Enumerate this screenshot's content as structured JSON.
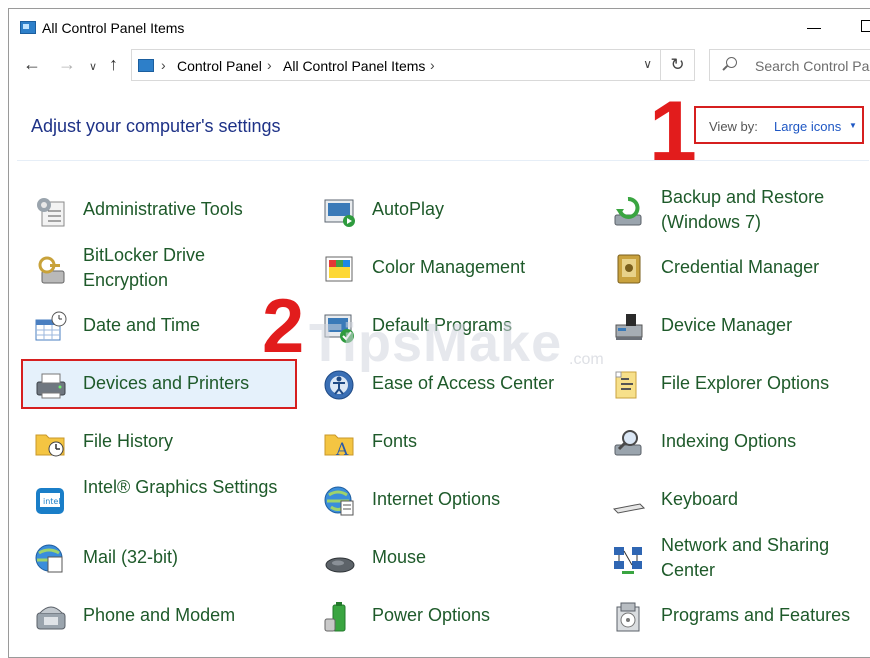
{
  "window": {
    "title": "All Control Panel Items"
  },
  "nav": {
    "breadcrumbs": [
      "Control Panel",
      "All Control Panel Items"
    ],
    "search_placeholder": "Search Control Panel"
  },
  "header": {
    "heading": "Adjust your computer's settings",
    "view_by_label": "View by:",
    "view_by_value": "Large icons"
  },
  "annotations": [
    "1",
    "2"
  ],
  "watermark": {
    "brand": "TipsMake",
    "suffix": ".com"
  },
  "items": [
    {
      "label": "Administrative Tools",
      "icon": "administrative-tools-icon"
    },
    {
      "label": "AutoPlay",
      "icon": "autoplay-icon"
    },
    {
      "label": "Backup and Restore (Windows 7)",
      "icon": "backup-restore-icon"
    },
    {
      "label": "BitLocker Drive Encryption",
      "icon": "bitlocker-icon"
    },
    {
      "label": "Color Management",
      "icon": "color-management-icon"
    },
    {
      "label": "Credential Manager",
      "icon": "credential-manager-icon"
    },
    {
      "label": "Date and Time",
      "icon": "date-time-icon"
    },
    {
      "label": "Default Programs",
      "icon": "default-programs-icon"
    },
    {
      "label": "Device Manager",
      "icon": "device-manager-icon"
    },
    {
      "label": "Devices and Printers",
      "icon": "devices-printers-icon",
      "selected": true
    },
    {
      "label": "Ease of Access Center",
      "icon": "ease-of-access-icon"
    },
    {
      "label": "File Explorer Options",
      "icon": "file-explorer-options-icon"
    },
    {
      "label": "File History",
      "icon": "file-history-icon"
    },
    {
      "label": "Fonts",
      "icon": "fonts-icon"
    },
    {
      "label": "Indexing Options",
      "icon": "indexing-options-icon"
    },
    {
      "label": "Intel® Graphics Settings",
      "icon": "intel-graphics-icon"
    },
    {
      "label": "Internet Options",
      "icon": "internet-options-icon"
    },
    {
      "label": "Keyboard",
      "icon": "keyboard-icon"
    },
    {
      "label": "Mail (32-bit)",
      "icon": "mail-icon"
    },
    {
      "label": "Mouse",
      "icon": "mouse-icon"
    },
    {
      "label": "Network and Sharing Center",
      "icon": "network-sharing-icon"
    },
    {
      "label": "Phone and Modem",
      "icon": "phone-modem-icon"
    },
    {
      "label": "Power Options",
      "icon": "power-options-icon"
    },
    {
      "label": "Programs and Features",
      "icon": "programs-features-icon"
    }
  ]
}
